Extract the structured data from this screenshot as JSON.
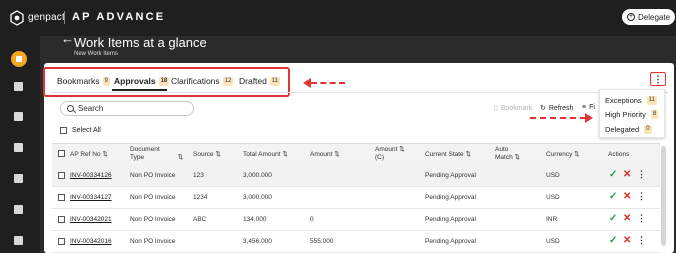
{
  "header": {
    "brand": "genpact",
    "app_name": "AP ADVANCE",
    "delegate_button": "Delegate"
  },
  "page": {
    "title": "Work Items at a glance",
    "subtitle": "New Work Items"
  },
  "tabs": [
    {
      "label": "Bookmarks",
      "count": "9"
    },
    {
      "label": "Approvals",
      "count": "18"
    },
    {
      "label": "Clarifications",
      "count": "12"
    },
    {
      "label": "Drafted",
      "count": "11"
    }
  ],
  "menu": [
    {
      "label": "Exceptions",
      "count": "11"
    },
    {
      "label": "High Priority",
      "count": "8"
    },
    {
      "label": "Delegated",
      "count": "0"
    }
  ],
  "toolbar": {
    "search_placeholder": "Search",
    "bookmark_label": "Bookmark",
    "refresh_label": "Refresh",
    "filter_label": "Fi",
    "select_all_label": "Select All"
  },
  "table": {
    "headers": [
      "AP Ref No",
      "Document Type",
      "Source",
      "Total Amount",
      "Amount",
      "Amount (C)",
      "Current State",
      "Auto Match",
      "Currency",
      "Actions"
    ],
    "header_lines": {
      "doc_type_1": "Document",
      "doc_type_2": "Type",
      "amount_c_1": "Amount",
      "amount_c_2": "(C)",
      "auto_match_1": "Auto",
      "auto_match_2": "Match"
    },
    "rows": [
      {
        "ref": "INV-00334126",
        "doc_type": "Non PO Invoice",
        "source": "123",
        "total": "3,000.000",
        "amount": "",
        "amount_c": "",
        "state": "Pending Approval",
        "auto_match": "",
        "currency": "USD"
      },
      {
        "ref": "INV-00334127",
        "doc_type": "Non PO Invoice",
        "source": "1234",
        "total": "3,000.000",
        "amount": "",
        "amount_c": "",
        "state": "Pending Approval",
        "auto_match": "",
        "currency": "USD"
      },
      {
        "ref": "INV-00342021",
        "doc_type": "Non PO Invoice",
        "source": "ABC",
        "total": "134.000",
        "amount": "0",
        "amount_c": "",
        "state": "Pending Approval",
        "auto_match": "",
        "currency": "INR"
      },
      {
        "ref": "INV-00342016",
        "doc_type": "Non PO Invoice",
        "source": "",
        "total": "3,456.000",
        "amount": "555.000",
        "amount_c": "",
        "state": "Pending Approval",
        "auto_match": "",
        "currency": "USD"
      }
    ]
  },
  "colors": {
    "accent_orange": "#f5a623",
    "annotation_red": "#e03535",
    "approve_green": "#1e9e4a",
    "reject_red": "#d93025",
    "badge_bg": "#fbe4b8"
  }
}
